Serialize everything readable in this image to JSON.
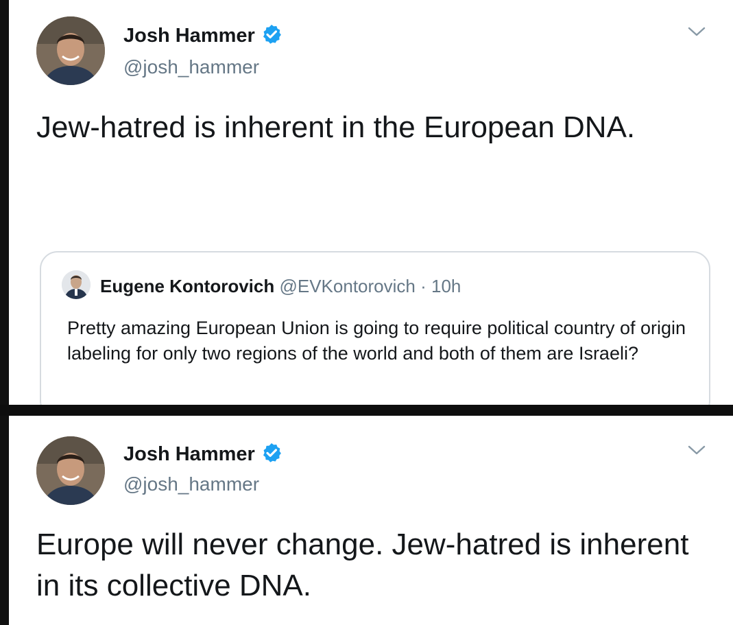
{
  "tweets": [
    {
      "author": {
        "name": "Josh Hammer",
        "handle": "@josh_hammer",
        "verified": true
      },
      "text": "Jew-hatred is inherent in the European DNA.",
      "quoted_tweet": {
        "author_name": "Eugene Kontorovich",
        "author_handle": "@EVKontorovich",
        "separator": "·",
        "time": "10h",
        "text": "Pretty amazing European Union is going to require political  country of origin labeling for only two regions of the world and both of them are Israeli?"
      }
    },
    {
      "author": {
        "name": "Josh Hammer",
        "handle": "@josh_hammer",
        "verified": true
      },
      "text": "Europe will never change. Jew-hatred is inherent in its collective DNA."
    }
  ],
  "icons": {
    "verified": "verified-badge-icon",
    "menu": "chevron-down-icon"
  },
  "colors": {
    "verified_blue": "#1da1f2",
    "secondary_text": "#657786",
    "primary_text": "#14171a",
    "card_border": "#d6dbe0"
  }
}
